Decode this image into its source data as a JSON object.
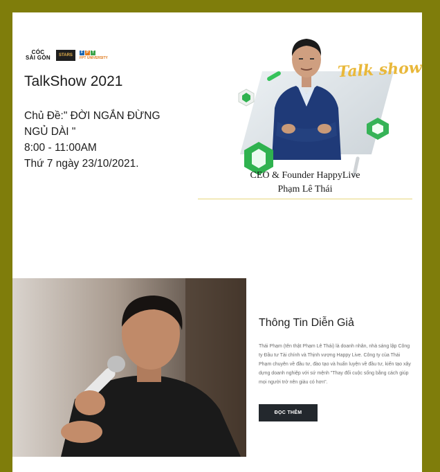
{
  "logos": {
    "coc_line1": "CÓC",
    "coc_line2": "SÀI GÒN",
    "stars": "STARS",
    "fpt_letters": [
      "F",
      "P",
      "T"
    ],
    "fpt_uni": "FPT UNIVERSITY"
  },
  "event": {
    "title": "TalkShow 2021",
    "topic_line1": "Chủ Đề:\" ĐỜI NGẮN ĐỪNG",
    "topic_line2": "NGỦ DÀI \"",
    "time": "8:00 - 11:00AM",
    "date": "Thứ 7 ngày 23/10/2021."
  },
  "poster": {
    "script": "Talk show",
    "caption_role": "CEO & Founder HappyLive",
    "caption_name": "Phạm Lê Thái"
  },
  "speaker": {
    "heading": "Thông Tin Diễn Giả",
    "bio": "Thái Phạm (tên thật Phạm Lê Thái) là doanh nhân, nhà sáng lập Công ty Đầu tư Tài chính và Thịnh vượng Happy Live. Công ty của Thái Phạm chuyên về đầu tư, đào tạo và huấn luyện về đầu tư, kiến tạo xây dựng doanh nghiệp với sứ mệnh \"Thay đổi cuộc sống bằng cách giúp mọi người trở nên giàu có hơn\".",
    "button": "ĐỌC THÊM"
  },
  "colors": {
    "frame": "#7f7d0b",
    "accent_yellow": "#e9b83a",
    "gem_green": "#2fb24f",
    "button_dark": "#23282d"
  }
}
